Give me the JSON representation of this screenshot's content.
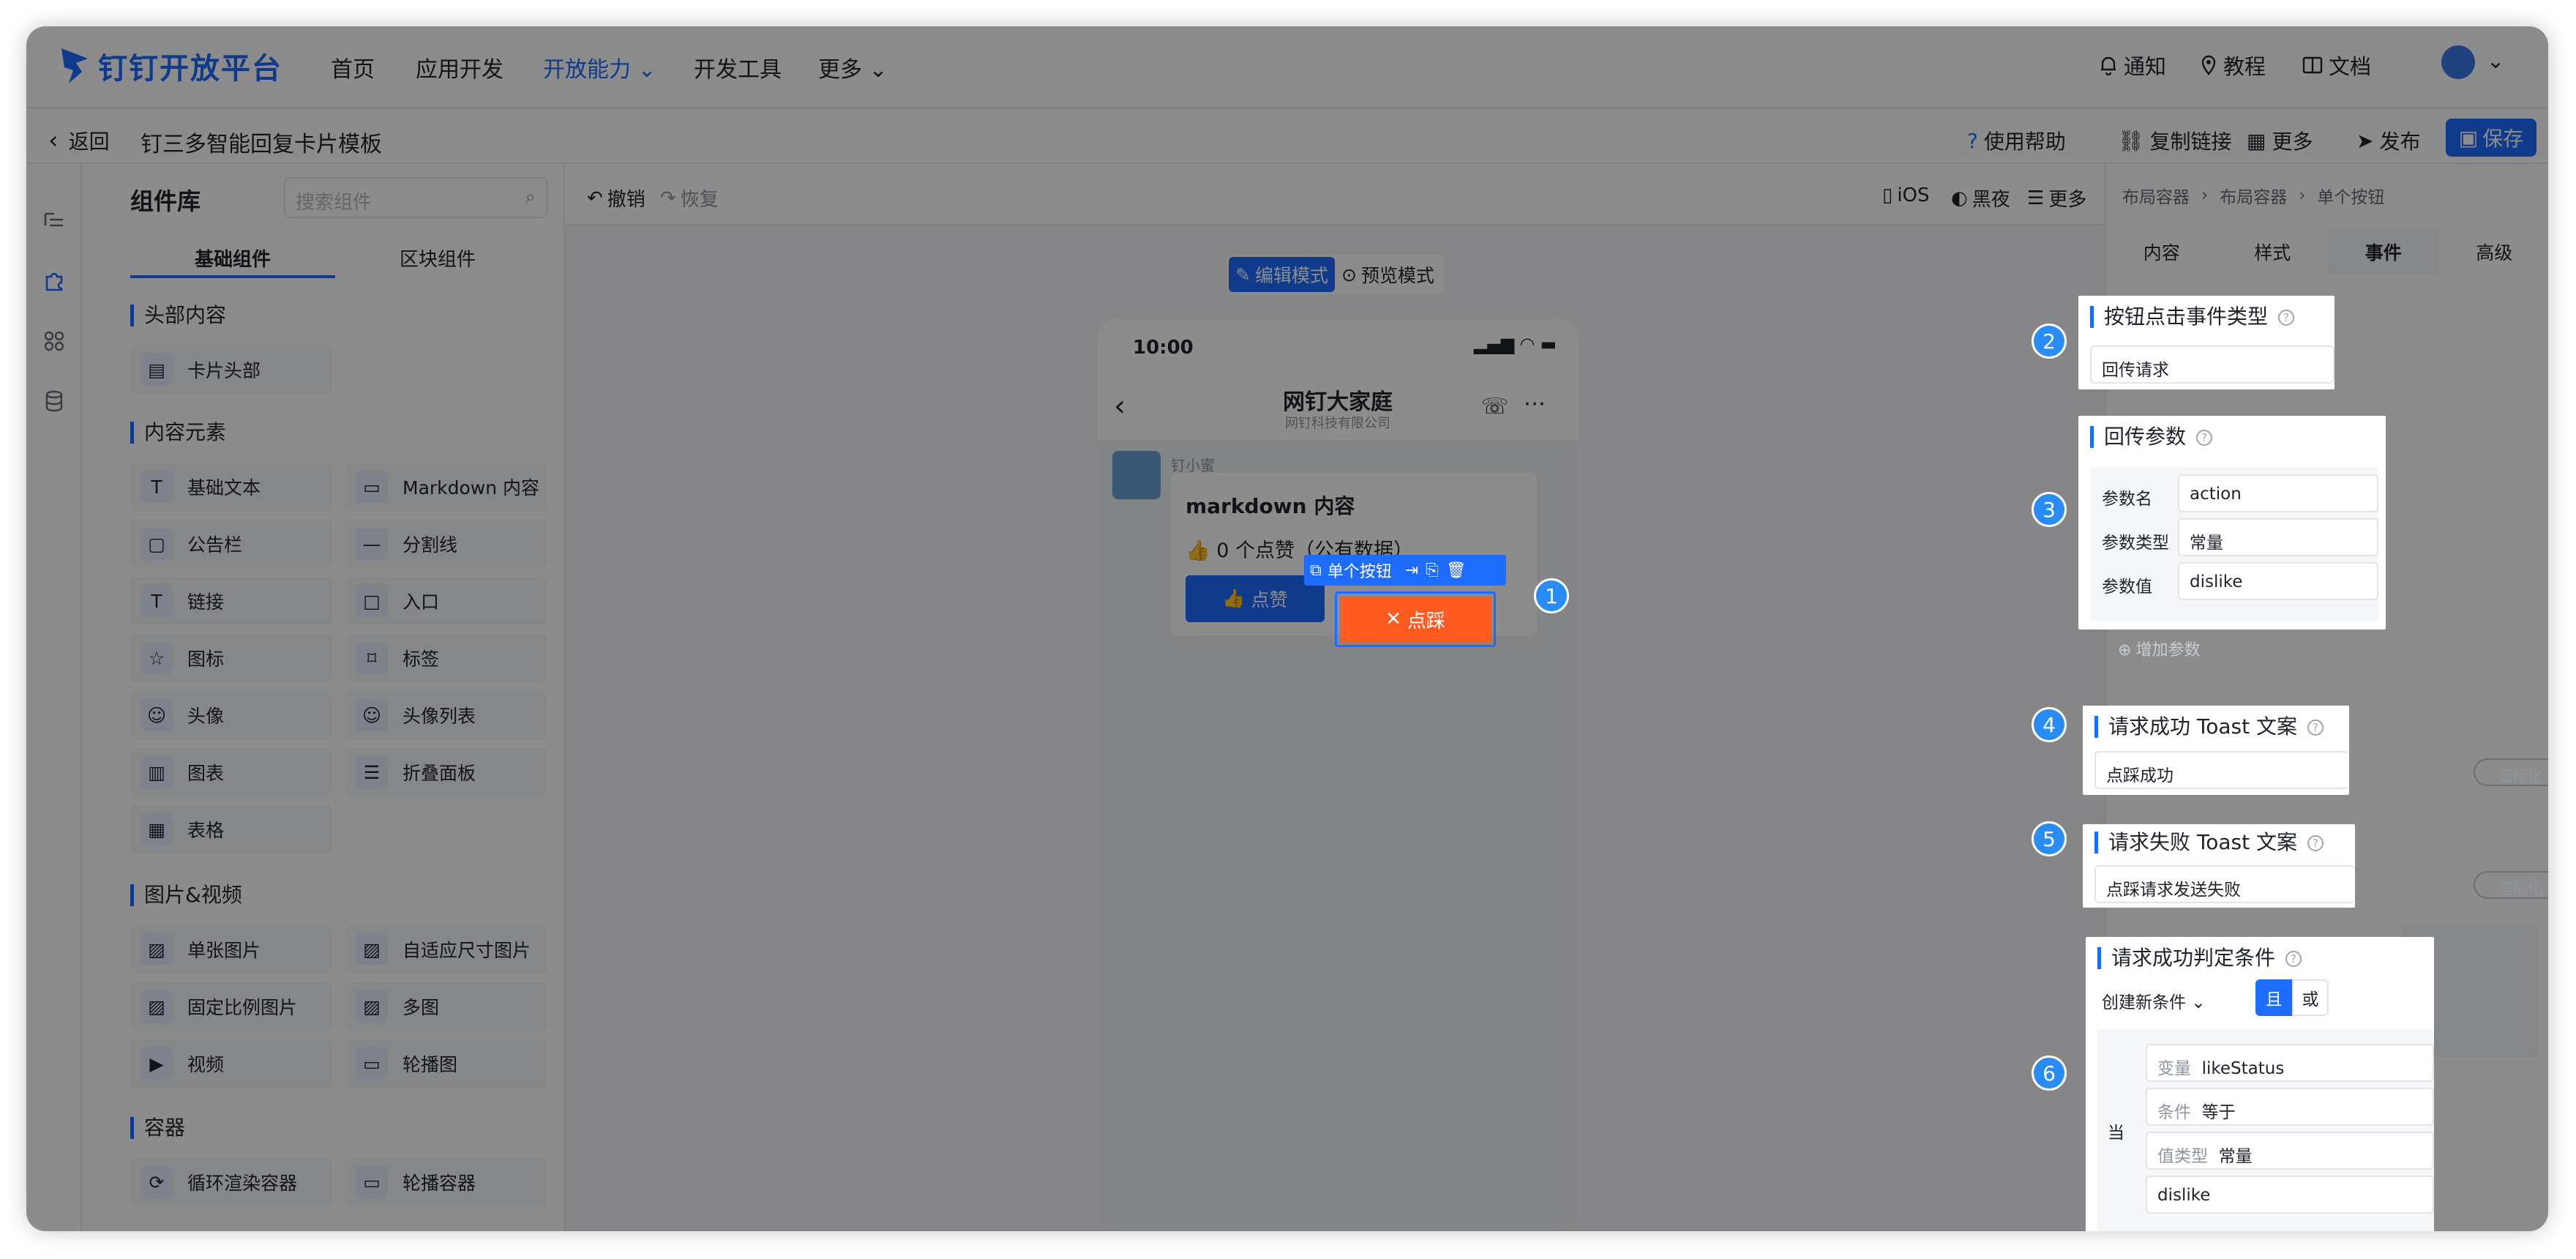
{
  "app": {
    "brand": "钉钉开放平台",
    "nav": [
      "首页",
      "应用开发",
      "开放能力",
      "开发工具",
      "更多"
    ],
    "right_nav": [
      "通知",
      "教程",
      "文档"
    ]
  },
  "subbar": {
    "back": "返回",
    "title": "钉三多智能回复卡片模板",
    "actions": [
      "使用帮助",
      "复制链接",
      "更多",
      "发布"
    ],
    "save": "保存"
  },
  "library": {
    "title": "组件库",
    "search_placeholder": "搜索组件",
    "tabs": [
      "基础组件",
      "区块组件"
    ],
    "sections": [
      {
        "title": "头部内容",
        "items": [
          "卡片头部"
        ]
      },
      {
        "title": "内容元素",
        "items": [
          "基础文本",
          "Markdown 内容",
          "公告栏",
          "分割线",
          "链接",
          "入口",
          "图标",
          "标签",
          "头像",
          "头像列表",
          "图表",
          "折叠面板",
          "表格"
        ]
      },
      {
        "title": "图片&视频",
        "items": [
          "单张图片",
          "自适应尺寸图片",
          "固定比例图片",
          "多图",
          "视频",
          "轮播图"
        ]
      },
      {
        "title": "容器",
        "items": [
          "循环渲染容器",
          "轮播容器"
        ]
      }
    ]
  },
  "canvas": {
    "undo": "撤销",
    "redo": "恢复",
    "right_tools": [
      "iOS",
      "黑夜",
      "更多"
    ],
    "mode_edit": "编辑模式",
    "mode_preview": "预览模式",
    "phone": {
      "time": "10:00",
      "chat_title": "网钉大家庭",
      "chat_subtitle": "网钉科技有限公司",
      "sender": "钉小蜜",
      "card_title": "markdown 内容",
      "likes_text": "0 个点赞（公有数据）",
      "like_btn": "点赞",
      "dislike_btn": "点踩",
      "selected_tag": "单个按钮"
    }
  },
  "props": {
    "breadcrumb": [
      "布局容器",
      "布局容器",
      "单个按钮"
    ],
    "tabs": [
      "内容",
      "样式",
      "事件",
      "高级"
    ],
    "event_type_label": "按钮点击事件类型",
    "event_type_value": "回传请求",
    "params_label": "回传参数",
    "param_name_label": "参数名",
    "param_name_value": "action",
    "param_type_label": "参数类型",
    "param_type_value": "常量",
    "param_value_label": "参数值",
    "param_value_value": "dislike",
    "add_param": "增加参数",
    "success_toast_label": "请求成功 Toast 文案",
    "success_toast_value": "点踩成功",
    "fail_toast_label": "请求失败 Toast 文案",
    "fail_toast_value": "点踩请求发送失败",
    "i18n": "国际化",
    "cond_label": "请求成功判定条件",
    "cond_new": "创建新条件",
    "cond_and": "且",
    "cond_or": "或",
    "cond_when": "当",
    "cond_var_label": "变量",
    "cond_var_value": "likeStatus",
    "cond_op_label": "条件",
    "cond_op_value": "等于",
    "cond_vtype_label": "值类型",
    "cond_vtype_value": "常量",
    "cond_value": "dislike"
  },
  "badges": [
    "1",
    "2",
    "3",
    "4",
    "5",
    "6"
  ]
}
